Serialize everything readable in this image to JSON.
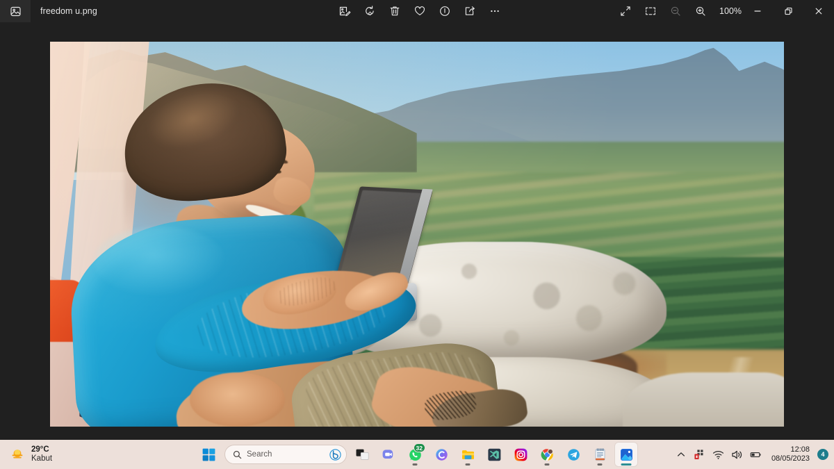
{
  "window": {
    "app_icon": "photo-icon",
    "file_name": "freedom u.png",
    "zoom_level": "100%",
    "toolbar": [
      {
        "name": "edit-image",
        "label": "Edit image"
      },
      {
        "name": "rotate",
        "label": "Rotate"
      },
      {
        "name": "delete",
        "label": "Delete"
      },
      {
        "name": "favorite",
        "label": "Add to favorites"
      },
      {
        "name": "file-info",
        "label": "File info"
      },
      {
        "name": "share",
        "label": "Share"
      },
      {
        "name": "see-more",
        "label": "See more"
      }
    ],
    "view_controls": [
      {
        "name": "fullscreen",
        "label": "Full screen"
      },
      {
        "name": "fit-to-window",
        "label": "Fit to window"
      },
      {
        "name": "zoom-out",
        "label": "Zoom out",
        "disabled": true
      },
      {
        "name": "zoom-in",
        "label": "Zoom in"
      }
    ],
    "controls": [
      {
        "name": "minimize",
        "label": "Minimize"
      },
      {
        "name": "restore",
        "label": "Restore"
      },
      {
        "name": "close",
        "label": "Close"
      }
    ]
  },
  "photo": {
    "alt": "Man in blue fleece sitting on mountain rocks using a laptop overlooking a green valley",
    "subject": "man with laptop",
    "scene": "mountain viewpoint over valley"
  },
  "taskbar": {
    "weather": {
      "temperature": "29°C",
      "condition": "Kabut",
      "icon": "sun-haze-icon"
    },
    "start": {
      "label": "Start",
      "icon": "windows-icon"
    },
    "search": {
      "placeholder": "Search",
      "icon": "search-icon",
      "copilot_icon": "bing-chat-icon"
    },
    "apps": [
      {
        "name": "task-view",
        "label": "Task view",
        "running": false,
        "badge": ""
      },
      {
        "name": "chat-teams",
        "label": "Chat",
        "running": false,
        "badge": ""
      },
      {
        "name": "whatsapp",
        "label": "WhatsApp",
        "running": true,
        "badge": "32"
      },
      {
        "name": "copilot",
        "label": "Copilot",
        "running": false,
        "badge": ""
      },
      {
        "name": "file-explorer",
        "label": "File Explorer",
        "running": true,
        "badge": ""
      },
      {
        "name": "visual-studio",
        "label": "Visual Studio",
        "running": false,
        "badge": ""
      },
      {
        "name": "instagram",
        "label": "Instagram",
        "running": false,
        "badge": ""
      },
      {
        "name": "google-chrome",
        "label": "Google Chrome",
        "running": true,
        "badge": ""
      },
      {
        "name": "telegram",
        "label": "Telegram",
        "running": false,
        "badge": ""
      },
      {
        "name": "notepad",
        "label": "Notepad",
        "running": true,
        "badge": ""
      },
      {
        "name": "photos",
        "label": "Photos",
        "running": true,
        "badge": "",
        "active": true
      }
    ],
    "tray": {
      "show_hidden": "Show hidden icons",
      "icons": [
        {
          "name": "app-tray-icon",
          "label": "Tray app"
        },
        {
          "name": "wifi-icon",
          "label": "Network"
        },
        {
          "name": "volume-icon",
          "label": "Volume"
        },
        {
          "name": "battery-icon",
          "label": "Battery"
        }
      ],
      "time": "12:08",
      "date": "08/05/2023",
      "notification_count": "4"
    }
  },
  "colors": {
    "window_bg": "#202020",
    "taskbar_bg": "#ede0da",
    "accent": "#2e8f93",
    "fleece_blue": "#1a9ccd",
    "badge_green": "#1a8f4a"
  }
}
